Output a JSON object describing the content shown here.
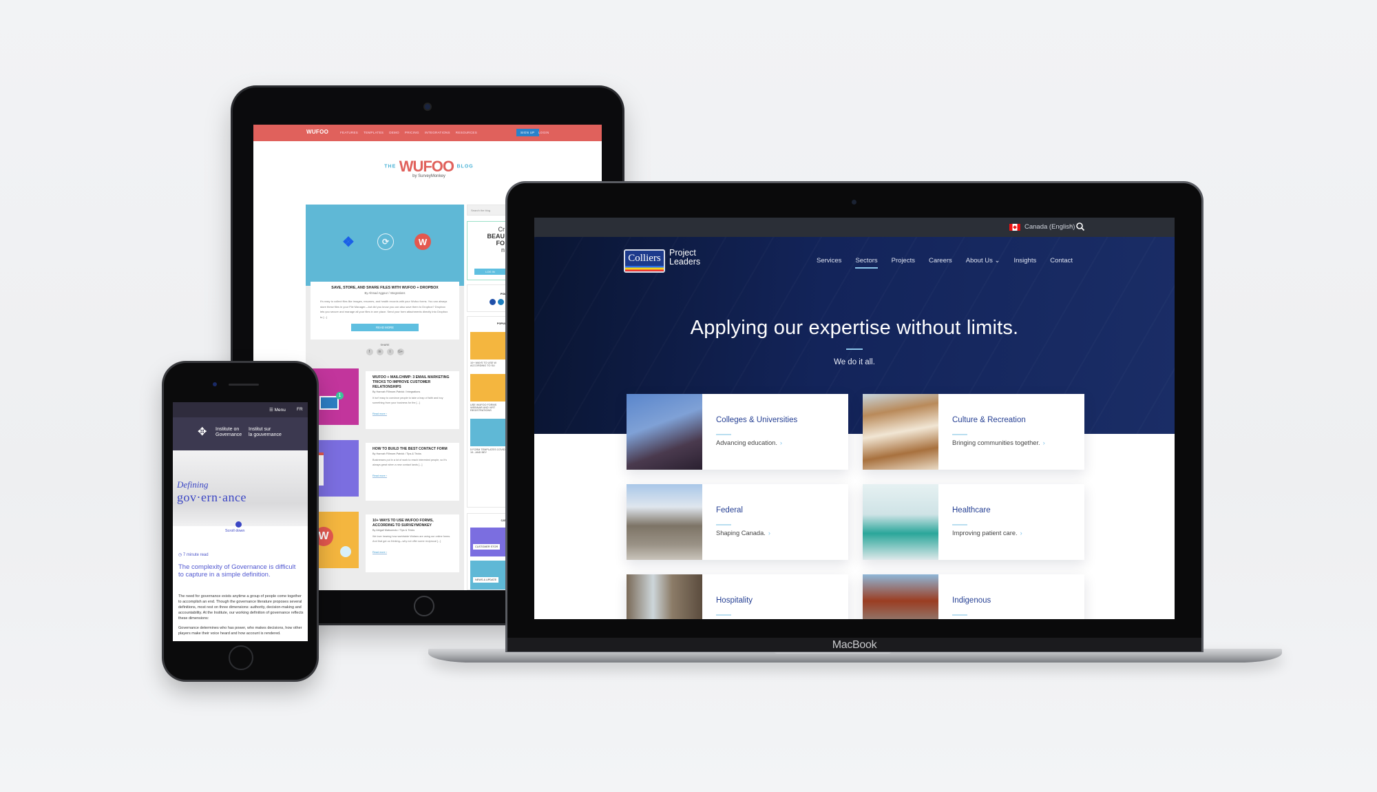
{
  "tablet": {
    "nav": {
      "logo": "WUFOO",
      "links": [
        "FEATURES",
        "TEMPLATES",
        "DEMO",
        "PRICING",
        "INTEGRATIONS",
        "RESOURCES"
      ],
      "signup": "SIGN UP",
      "login": "LOGIN"
    },
    "blog_header": {
      "the": "THE",
      "logo": "WUFOO",
      "blog": "BLOG",
      "by": "by SurveyMonkey"
    },
    "featured": {
      "title": "SAVE, STORE, AND SHARE FILES WITH WUFOO + DROPBOX",
      "meta": "By Ahmad Aggour / Integrations",
      "excerpt": "It's easy to collect files like images, resumes, and health records with your Wufoo forms. You can always store these files in your File Manager—but did you know you can also save them to Dropbox? Dropbox lets you secure and manage all your files in one place. Send your form attachments directly into Dropbox to [...]",
      "read_more": "READ MORE",
      "share_label": "SHARE",
      "share_icons": [
        "f",
        "in",
        "t",
        "G+"
      ]
    },
    "posts": [
      {
        "title": "WUFOO + MAILCHIMP: 3 EMAIL MARKETING TRICKS TO IMPROVE CUSTOMER RELATIONSHIPS",
        "meta": "By Hannah Fillmore-Patrick / Integrations",
        "excerpt": "It isn't easy to convince people to take a leap of faith and buy something from your business for the [...]",
        "read_more": "Read more ›",
        "color": "#c2359c"
      },
      {
        "title": "HOW TO BUILD THE BEST CONTACT FORM",
        "meta": "By Hannah Fillmore-Patrick / Tips & Tricks",
        "excerpt": "Businesses put in a lot of work to reach interested people, so it's always great when a new contact lands [...]",
        "read_more": "Read more ›",
        "color": "#7b6ee0"
      },
      {
        "title": "10+ WAYS TO USE WUFOO FORMS, ACCORDING TO SURVEYMONKEY",
        "meta": "By Abigail Matsumoto / Tips & Tricks",
        "excerpt": "We love hearing how worldwide Wufans are using our online forms. And that got us thinking—why not offer some reciprocal [...]",
        "read_more": "Read more ›",
        "color": "#f4b63f"
      }
    ],
    "sidebar": {
      "search_placeholder": "Search the blog",
      "promo_lines": [
        "Cr",
        "BEAU",
        "FO",
        "n"
      ],
      "promo_button": "LOG IN",
      "follow_label": "FOL",
      "popular_label": "POPUL",
      "popular_items": [
        "10+ WAYS TO USE W ACCORDING TO SU",
        "USE WUFOO FORMS WEBINAR AND VIRT REGISTRATIONS",
        "5 FORM TEMPLATES COVID-19...AND BEY"
      ],
      "categories_label": "CAT",
      "categories": [
        "CUSTOMER STOR",
        "NEWS & UPDATE"
      ]
    }
  },
  "laptop": {
    "brand": "MacBook",
    "topbar": {
      "language": "Canada (English)",
      "caret": "▾"
    },
    "logo": {
      "mark": "Colliers",
      "line1": "Project",
      "line2": "Leaders"
    },
    "nav": [
      {
        "label": "Services",
        "active": false
      },
      {
        "label": "Sectors",
        "active": true
      },
      {
        "label": "Projects",
        "active": false
      },
      {
        "label": "Careers",
        "active": false
      },
      {
        "label": "About Us ⌄",
        "active": false
      },
      {
        "label": "Insights",
        "active": false
      },
      {
        "label": "Contact",
        "active": false
      }
    ],
    "hero": {
      "title": "Applying our expertise without limits.",
      "subtitle": "We do it all."
    },
    "sectors": [
      {
        "title": "Colleges & Universities",
        "subtitle": "Advancing education.",
        "arrow": "›"
      },
      {
        "title": "Culture & Recreation",
        "subtitle": "Bringing communities together.",
        "arrow": "›"
      },
      {
        "title": "Federal",
        "subtitle": "Shaping Canada.",
        "arrow": "›"
      },
      {
        "title": "Healthcare",
        "subtitle": "Improving patient care.",
        "arrow": "›"
      },
      {
        "title": "Hospitality",
        "subtitle": "",
        "arrow": ""
      },
      {
        "title": "Indigenous",
        "subtitle": "",
        "arrow": ""
      }
    ]
  },
  "phone": {
    "menu": "☰ Menu",
    "lang": "FR",
    "org_en": [
      "Institute on",
      "Governance"
    ],
    "org_fr": [
      "Institut sur",
      "la gouvernance"
    ],
    "hero_kicker": "Defining",
    "hero_word": "gov·ern·ance",
    "scroll": "Scroll down",
    "read_time": "7 minute read",
    "pull_quote": "The complexity of Governance is difficult to capture in a simple definition.",
    "body1": "The need for governance exists anytime a group of people come together to accomplish an end. Though the governance literature proposes several definitions, most rest on three dimensions: authority, decision-making and accountability. At the Institute, our working definition of governance reflects these dimensions:",
    "body2": "Governance determines who has power, who makes decisions, how other players make their voice heard and how account is rendered."
  }
}
